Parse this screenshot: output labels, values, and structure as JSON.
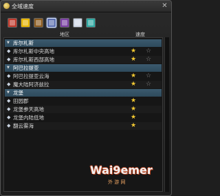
{
  "window": {
    "title": "全域速度"
  },
  "filters": [
    {
      "icon": "battle-icon",
      "color": "#c0392b",
      "active": false
    },
    {
      "icon": "gold-coin-icon",
      "color": "#e6b400",
      "active": false
    },
    {
      "icon": "crafter-icon",
      "color": "#8a5a1e",
      "active": false
    },
    {
      "icon": "gatherer-icon",
      "color": "#5b6fae",
      "active": true
    },
    {
      "icon": "purple-class-icon",
      "color": "#7a3fa3",
      "active": false
    },
    {
      "icon": "swirl-icon",
      "color": "#cfd7e6",
      "active": false
    },
    {
      "icon": "teal-class-icon",
      "color": "#2fa8a2",
      "active": false
    }
  ],
  "columns": {
    "region": "地区",
    "speed": "速度"
  },
  "rows": [
    {
      "type": "group",
      "label": "库尔札斯"
    },
    {
      "type": "item",
      "label": "库尔札斯中央高地",
      "stars": 1
    },
    {
      "type": "item",
      "label": "库尔札斯西部高地",
      "stars": 1
    },
    {
      "type": "group",
      "label": "阿巴拉提亚"
    },
    {
      "type": "item",
      "label": "阿巴拉提亚云海",
      "stars": 1
    },
    {
      "type": "item",
      "label": "魔大陆阿济兹拉",
      "stars": 1
    },
    {
      "type": "group",
      "label": "龙堡"
    },
    {
      "type": "item",
      "label": "田园郡",
      "stars": 1,
      "single": true
    },
    {
      "type": "item",
      "label": "龙堡参天高地",
      "stars": 1,
      "single": true
    },
    {
      "type": "item",
      "label": "龙堡内陆低地",
      "stars": 1,
      "single": true
    },
    {
      "type": "item",
      "label": "翻云雾海",
      "stars": 1,
      "single": true
    }
  ],
  "watermark": {
    "brand": "Wai9emer",
    "sub": "外 游 网"
  }
}
